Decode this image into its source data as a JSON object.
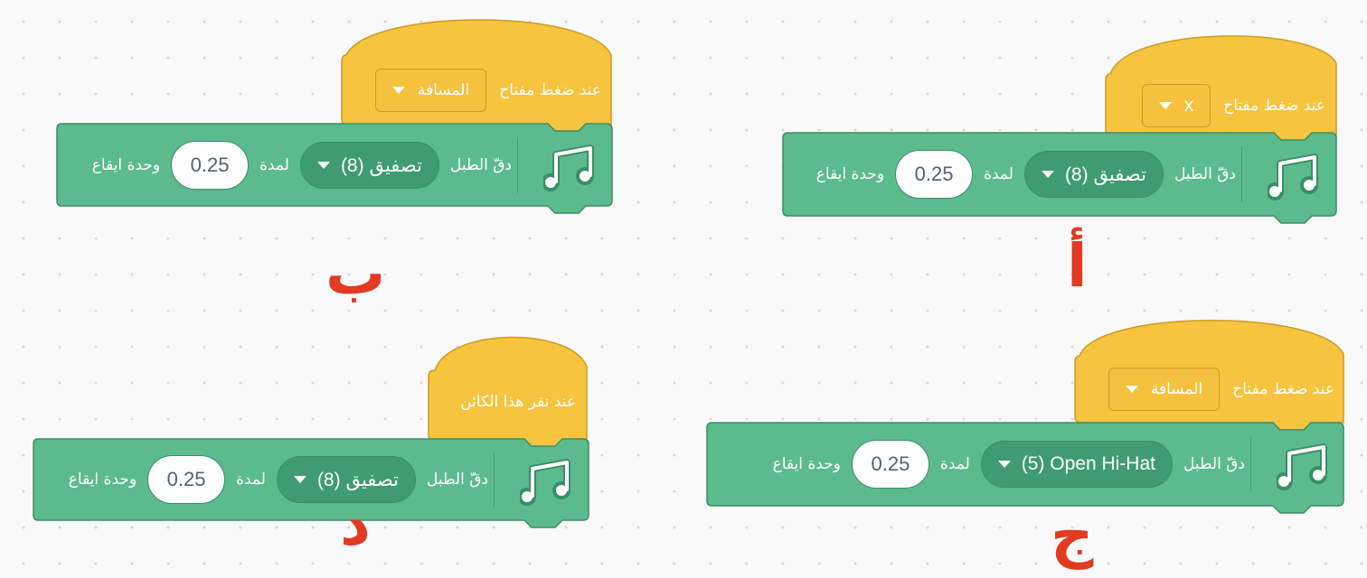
{
  "colors": {
    "hat_fill": "#f7c43f",
    "hat_stroke": "#cc9b24",
    "stack_fill": "#5cbb8d",
    "stack_stroke": "#3a8e66",
    "label_red": "#e23a23"
  },
  "scripts": [
    {
      "id": "a",
      "label": "أ",
      "hat": {
        "text": "عند ضغط مفتاح",
        "key": "x"
      },
      "block": {
        "icon": "music-notes-icon",
        "text_play": "دقّ الطبل",
        "drum": "(8) تصفيق",
        "text_for": "لمدة",
        "beats": "0.25",
        "text_beats": "وحدة ايقاع"
      }
    },
    {
      "id": "b",
      "label": "ب",
      "hat": {
        "text": "عند ضغط مفتاح",
        "key": "المسافة"
      },
      "block": {
        "icon": "music-notes-icon",
        "text_play": "دقّ الطبل",
        "drum": "(8) تصفيق",
        "text_for": "لمدة",
        "beats": "0.25",
        "text_beats": "وحدة ايقاع"
      }
    },
    {
      "id": "c",
      "label": "ج",
      "hat": {
        "text": "عند ضغط مفتاح",
        "key": "المسافة"
      },
      "block": {
        "icon": "music-notes-icon",
        "text_play": "دقّ الطبل",
        "drum": "(5) Open Hi-Hat",
        "text_for": "لمدة",
        "beats": "0.25",
        "text_beats": "وحدة ايقاع"
      }
    },
    {
      "id": "d",
      "label": "د",
      "hat": {
        "text": "عند نقر هذا الكائن"
      },
      "block": {
        "icon": "music-notes-icon",
        "text_play": "دقّ الطبل",
        "drum": "(8) تصفيق",
        "text_for": "لمدة",
        "beats": "0.25",
        "text_beats": "وحدة ايقاع"
      }
    }
  ]
}
